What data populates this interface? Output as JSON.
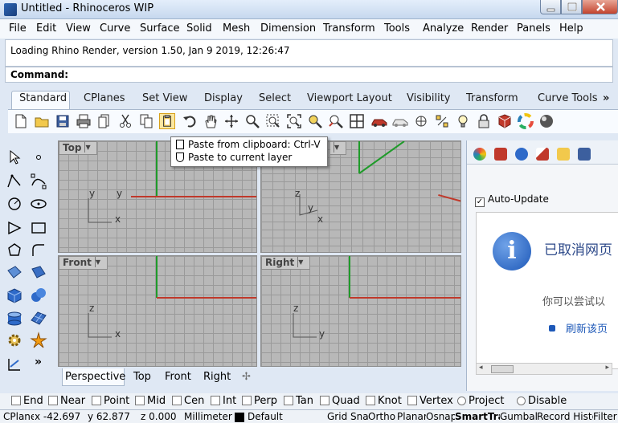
{
  "window": {
    "title": "Untitled - Rhinoceros WIP"
  },
  "menubar": [
    "File",
    "Edit",
    "View",
    "Curve",
    "Surface",
    "Solid",
    "Mesh",
    "Dimension",
    "Transform",
    "Tools",
    "Analyze",
    "Render",
    "Panels",
    "Help"
  ],
  "command_history": "Loading Rhino Render, version 1.50, Jan  9 2019, 12:26:47",
  "command_prompt": "Command:",
  "toolbar_tabs": [
    "Standard",
    "CPlanes",
    "Set View",
    "Display",
    "Select",
    "Viewport Layout",
    "Visibility",
    "Transform",
    "Curve Tools"
  ],
  "toolbar_overflow": "»",
  "tooltip": {
    "line1": "Paste from clipboard: Ctrl-V",
    "line2": "Paste to current layer"
  },
  "viewports": {
    "top": {
      "title": "Top",
      "axis_y": "y",
      "axis_x": "x",
      "axis_y2": "y"
    },
    "perspective": {
      "axis_z": "z",
      "axis_y": "y",
      "axis_x": "x"
    },
    "front": {
      "title": "Front",
      "axis_z": "z",
      "axis_x": "x"
    },
    "right": {
      "title": "Right",
      "axis_z": "z",
      "axis_y": "y"
    }
  },
  "viewport_tabs": [
    "Perspective",
    "Top",
    "Front",
    "Right"
  ],
  "viewport_tab_add": "✢",
  "panel": {
    "auto_update_label": "Auto-Update",
    "title_cn": "已取消网页",
    "sub_cn": "你可以尝试以",
    "link_cn": "刷新该页"
  },
  "osnap": [
    "End",
    "Near",
    "Point",
    "Mid",
    "Cen",
    "Int",
    "Perp",
    "Tan",
    "Quad",
    "Knot",
    "Vertex"
  ],
  "osnap_radio": [
    "Project",
    "Disable"
  ],
  "status": {
    "cplane": "CPlane",
    "x": "x -42.697",
    "y": "y 62.877",
    "z": "z 0.000",
    "units": "Millimeters",
    "layer": "Default",
    "toggles": [
      "Grid Snap",
      "Ortho",
      "Planar",
      "Osnap",
      "SmartTrack",
      "Gumball",
      "Record History",
      "Filter"
    ]
  },
  "colors": {
    "accent": "#1d58b8",
    "x_axis": "#c0392b",
    "y_axis": "#27ae3a",
    "viewport_bg": "#b8b8b8"
  }
}
